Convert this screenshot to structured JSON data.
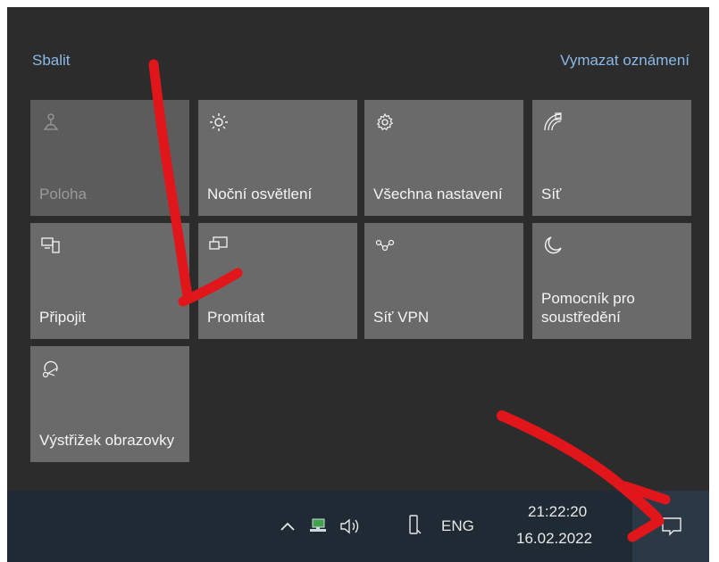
{
  "header": {
    "collapse_label": "Sbalit",
    "clear_notifications_label": "Vymazat oznámení"
  },
  "tiles": [
    {
      "label": "Poloha",
      "icon": "location-icon",
      "state": "disabled"
    },
    {
      "label": "Noční osvětlení",
      "icon": "brightness-icon",
      "state": "off"
    },
    {
      "label": "Všechna nastavení",
      "icon": "gear-icon",
      "state": "off"
    },
    {
      "label": "Síť",
      "icon": "network-icon",
      "state": "off"
    },
    {
      "label": "Připojit",
      "icon": "connect-icon",
      "state": "off"
    },
    {
      "label": "Promítat",
      "icon": "project-icon",
      "state": "off"
    },
    {
      "label": "Síť VPN",
      "icon": "vpn-icon",
      "state": "off"
    },
    {
      "label": "Pomocník pro soustředění",
      "icon": "moon-icon",
      "state": "off"
    },
    {
      "label": "Výstřižek obrazovky",
      "icon": "snip-icon",
      "state": "off"
    }
  ],
  "taskbar": {
    "language": "ENG",
    "time": "21:22:20",
    "date": "16.02.2022",
    "icons": [
      "chevron-up-icon",
      "network-monitor-icon",
      "speaker-icon",
      "usb-icon",
      "notification-icon"
    ]
  },
  "colors": {
    "panel_bg": "#2c2c2c",
    "tile_bg": "#6a6a6a",
    "link": "#8ab9e8",
    "taskbar_bg": "#1f2a34",
    "annotation": "#e0161b"
  }
}
